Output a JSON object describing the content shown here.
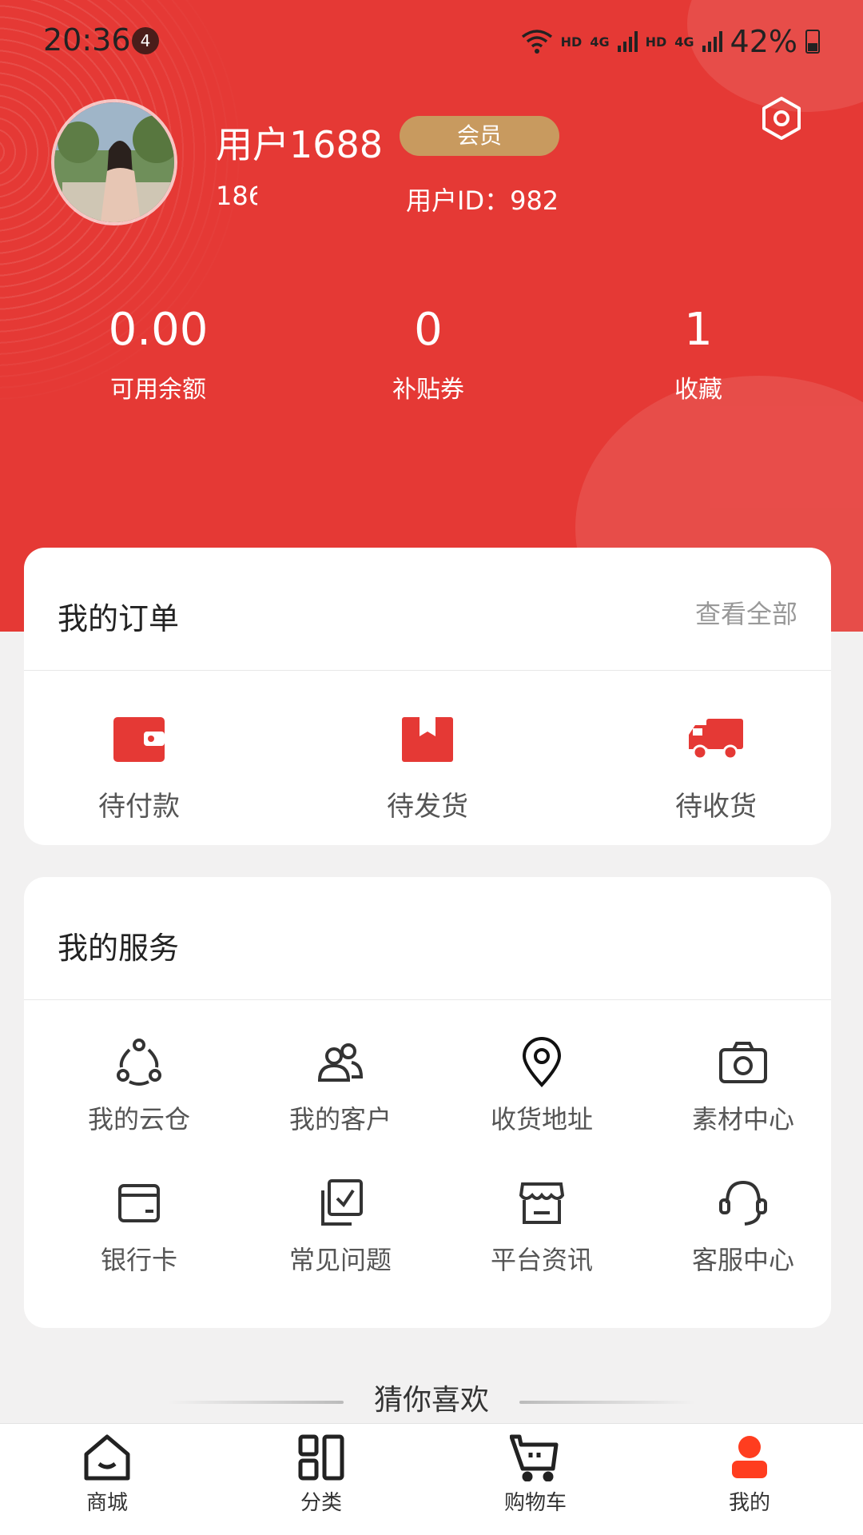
{
  "status_bar": {
    "time": "20:36",
    "notification_count": "4",
    "network_labels": [
      "HD",
      "4G",
      "HD",
      "4G"
    ],
    "battery_percent": "42%"
  },
  "profile": {
    "username": "用户1688",
    "badge": "会员",
    "phone": "186",
    "user_id": "用户ID：982"
  },
  "stats": [
    {
      "value": "0.00",
      "label": "可用余额"
    },
    {
      "value": "0",
      "label": "补贴券"
    },
    {
      "value": "1",
      "label": "收藏"
    }
  ],
  "orders": {
    "title": "我的订单",
    "view_all": "查看全部",
    "items": [
      {
        "label": "待付款",
        "icon": "wallet-icon"
      },
      {
        "label": "待发货",
        "icon": "package-icon"
      },
      {
        "label": "待收货",
        "icon": "truck-icon"
      }
    ]
  },
  "services": {
    "title": "我的服务",
    "items": [
      {
        "label": "我的云仓",
        "icon": "cloud-warehouse-icon"
      },
      {
        "label": "我的客户",
        "icon": "customers-icon"
      },
      {
        "label": "收货地址",
        "icon": "location-icon"
      },
      {
        "label": "素材中心",
        "icon": "camera-icon"
      },
      {
        "label": "银行卡",
        "icon": "bank-card-icon"
      },
      {
        "label": "常见问题",
        "icon": "faq-icon"
      },
      {
        "label": "平台资讯",
        "icon": "news-icon"
      },
      {
        "label": "客服中心",
        "icon": "headset-icon"
      }
    ]
  },
  "guess_title": "猜你喜欢",
  "tabbar": [
    {
      "label": "商城",
      "icon": "home-icon"
    },
    {
      "label": "分类",
      "icon": "category-icon"
    },
    {
      "label": "购物车",
      "icon": "cart-icon"
    },
    {
      "label": "我的",
      "icon": "profile-icon",
      "active": true
    }
  ],
  "colors": {
    "brand_red": "#e53935",
    "member_gold": "#c89a5f"
  }
}
